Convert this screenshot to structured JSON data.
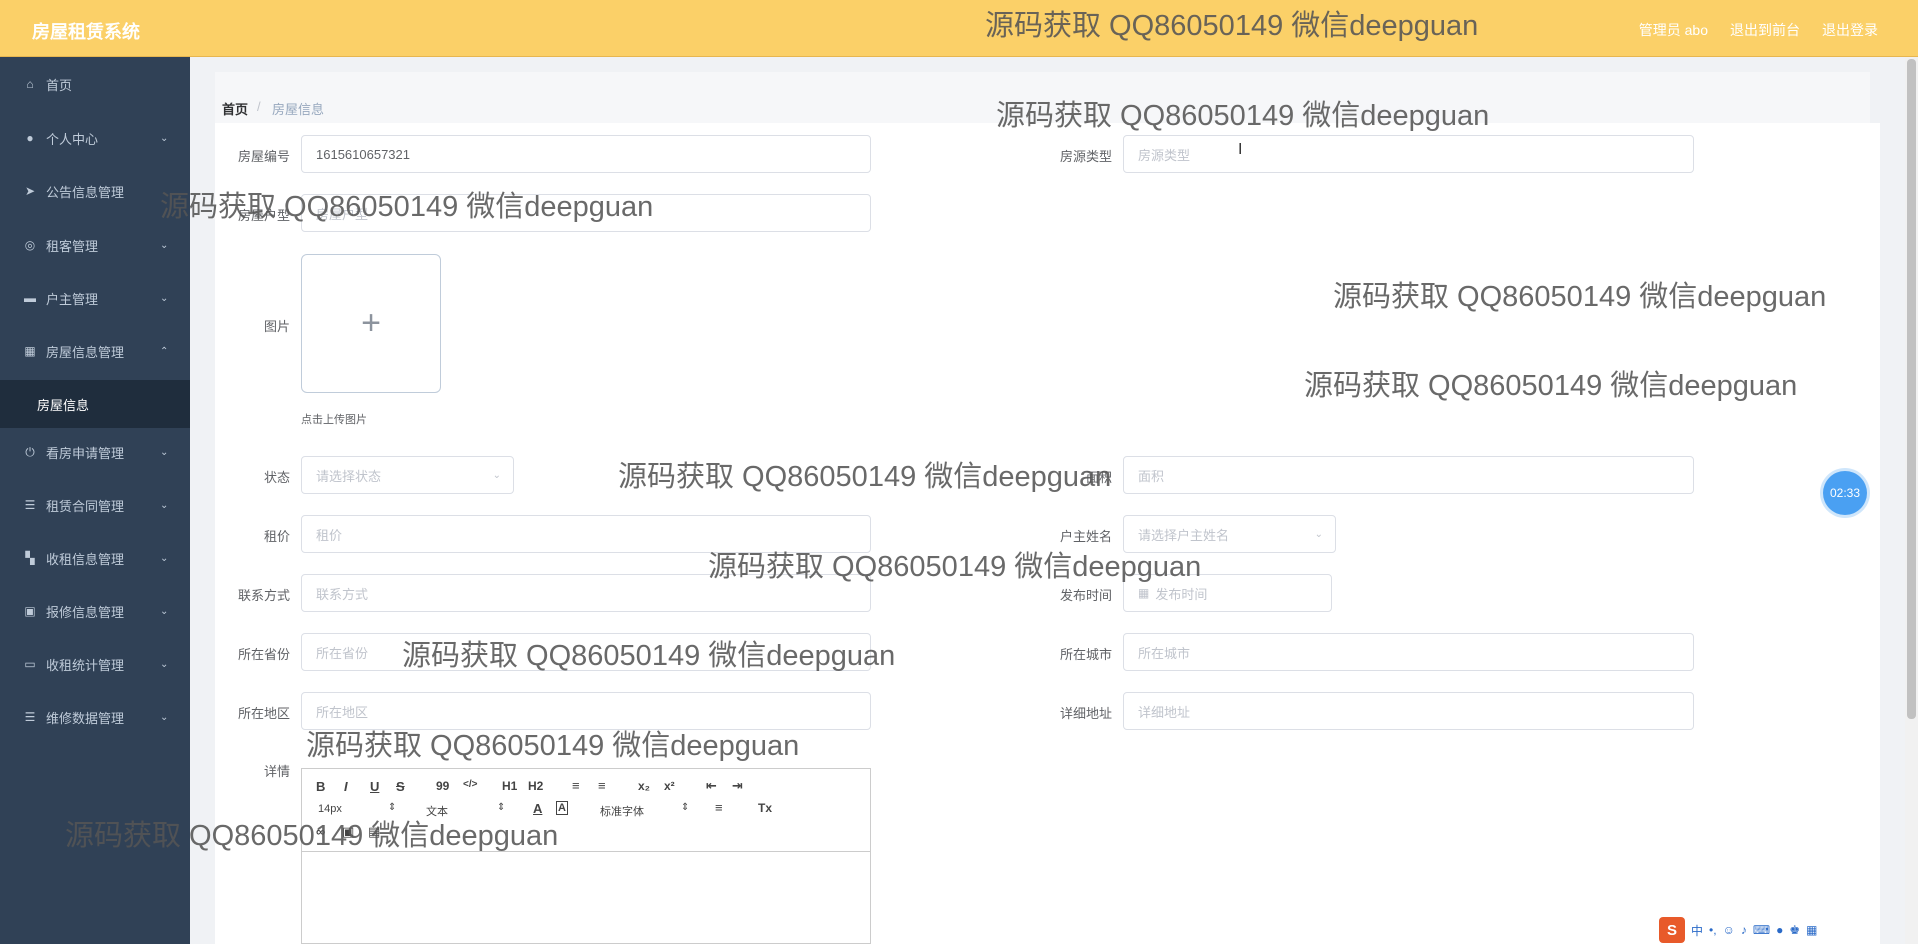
{
  "header": {
    "app_title": "房屋租赁系统",
    "user_label": "管理员 abo",
    "back_to_front": "退出到前台",
    "logout": "退出登录"
  },
  "sidebar": {
    "items": [
      {
        "label": "首页",
        "icon": "home-icon"
      },
      {
        "label": "个人中心",
        "icon": "user-icon"
      },
      {
        "label": "公告信息管理",
        "icon": "send-icon"
      },
      {
        "label": "租客管理",
        "icon": "basketball-icon"
      },
      {
        "label": "户主管理",
        "icon": "chair-icon"
      },
      {
        "label": "房屋信息管理",
        "icon": "grid-icon"
      },
      {
        "label": "房屋信息",
        "icon": ""
      },
      {
        "label": "看房申请管理",
        "icon": "power-icon"
      },
      {
        "label": "租赁合同管理",
        "icon": "menu-icon"
      },
      {
        "label": "收租信息管理",
        "icon": "apps-icon"
      },
      {
        "label": "报修信息管理",
        "icon": "tickets-icon"
      },
      {
        "label": "收租统计管理",
        "icon": "monitor-icon"
      },
      {
        "label": "维修数据管理",
        "icon": "menu-icon"
      }
    ]
  },
  "breadcrumb": {
    "home": "首页",
    "separator": "/",
    "current": "房屋信息"
  },
  "form": {
    "house_no": {
      "label": "房屋编号",
      "value": "1615610657321"
    },
    "house_source_type": {
      "label": "房源类型",
      "placeholder": "房源类型"
    },
    "house_layout": {
      "label": "房屋户型",
      "placeholder": "房屋户型"
    },
    "image": {
      "label": "图片",
      "plus": "+",
      "tip": "点击上传图片"
    },
    "status": {
      "label": "状态",
      "placeholder": "请选择状态"
    },
    "area": {
      "label": "面积",
      "placeholder": "面积"
    },
    "rent": {
      "label": "租价",
      "placeholder": "租价"
    },
    "owner_name": {
      "label": "户主姓名",
      "placeholder": "请选择户主姓名"
    },
    "contact": {
      "label": "联系方式",
      "placeholder": "联系方式"
    },
    "publish_time": {
      "label": "发布时间",
      "placeholder": "发布时间"
    },
    "province": {
      "label": "所在省份",
      "placeholder": "所在省份"
    },
    "city": {
      "label": "所在城市",
      "placeholder": "所在城市"
    },
    "district": {
      "label": "所在地区",
      "placeholder": "所在地区"
    },
    "address": {
      "label": "详细地址",
      "placeholder": "详细地址"
    },
    "details": {
      "label": "详情"
    }
  },
  "editor": {
    "bold": "B",
    "italic": "I",
    "underline": "U",
    "strike": "S",
    "quote": "99",
    "code": "</>",
    "h1": "H1",
    "h2": "H2",
    "ordered_list": "≡",
    "bullet_list": "≡",
    "subscript": "x₂",
    "superscript": "x²",
    "outdent": "⇤",
    "indent": "⇥",
    "font_size": "14px",
    "text_style": "文本",
    "font_color": "A",
    "bg_color": "A",
    "font_family": "标准字体",
    "align": "≡",
    "clean": "Tx"
  },
  "timer": "02:33",
  "watermark_text": "源码获取 QQ86050149 微信deepguan",
  "ime": {
    "logo": "S",
    "lang": "中"
  },
  "colors": {
    "header_bg": "#fbd068",
    "sidebar_bg": "#304156",
    "timer_bg": "#4aa0f2"
  }
}
